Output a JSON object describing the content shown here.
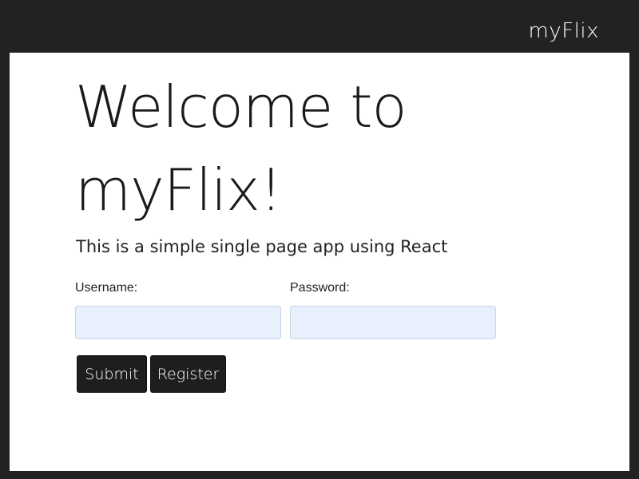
{
  "navbar": {
    "brand": "myFlix"
  },
  "main": {
    "title": "Welcome to myFlix!",
    "subtitle": "This is a simple single page app using React"
  },
  "login_form": {
    "username_label": "Username:",
    "username_value": "",
    "password_label": "Password:",
    "password_value": "",
    "submit_label": "Submit",
    "register_label": "Register"
  },
  "colors": {
    "background": "#222222",
    "panel": "#ffffff",
    "input_fill": "#e8f0fe",
    "button": "#1e1e1e"
  }
}
